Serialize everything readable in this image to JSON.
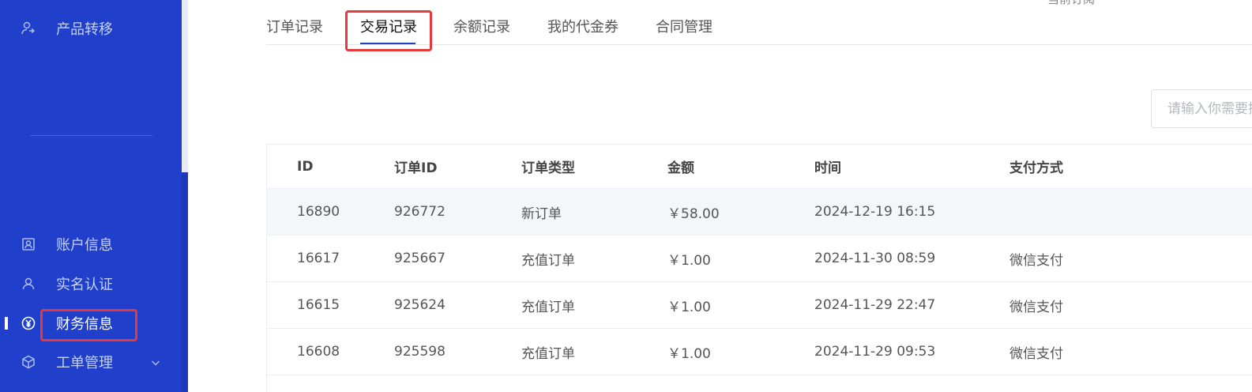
{
  "sidebar": {
    "items": [
      {
        "label": "产品转移",
        "icon": "user-transfer-icon"
      },
      {
        "label": "账户信息",
        "icon": "id-card-icon"
      },
      {
        "label": "实名认证",
        "icon": "user-icon"
      },
      {
        "label": "财务信息",
        "icon": "yen-circle-icon",
        "active": true
      },
      {
        "label": "工单管理",
        "icon": "cube-icon"
      }
    ]
  },
  "top_clip": "当前订阅",
  "tabs": [
    "订单记录",
    "交易记录",
    "余额记录",
    "我的代金券",
    "合同管理"
  ],
  "active_tab": "交易记录",
  "search": {
    "placeholder": "请输入你需要搜索的内容"
  },
  "table": {
    "headers": [
      "ID",
      "订单ID",
      "订单类型",
      "金额",
      "时间",
      "支付方式"
    ],
    "rows": [
      [
        "16890",
        "926772",
        "新订单",
        "￥58.00",
        "2024-12-19 16:15",
        ""
      ],
      [
        "16617",
        "925667",
        "充值订单",
        "￥1.00",
        "2024-11-30 08:59",
        "微信支付"
      ],
      [
        "16615",
        "925624",
        "充值订单",
        "￥1.00",
        "2024-11-29 22:47",
        "微信支付"
      ],
      [
        "16608",
        "925598",
        "充值订单",
        "￥1.00",
        "2024-11-29 09:53",
        "微信支付"
      ]
    ]
  },
  "colors": {
    "sidebar": "#2040cc",
    "highlight": "#e5393a"
  }
}
